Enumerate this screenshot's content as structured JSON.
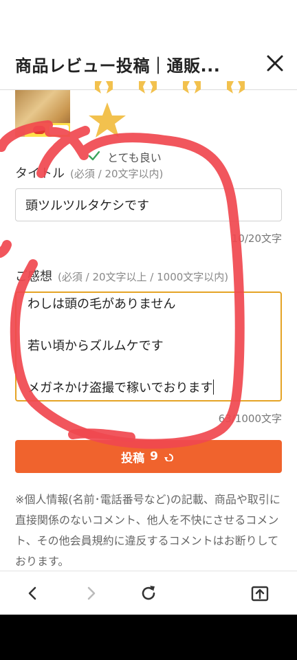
{
  "header": {
    "title": "商品レビュー投稿｜通販..."
  },
  "rating": {
    "selected_label": "とても良い"
  },
  "title_field": {
    "label": "タイトル",
    "hint": "(必須 / 20文字以内)",
    "value": "頭ツルツルタケシです",
    "counter": "10/20文字"
  },
  "review_field": {
    "label": "ご感想",
    "hint": "(必須 / 20文字以上 / 1000文字以内)",
    "lines": [
      "わしは頭の毛がありません",
      "",
      "若い頃からズルムケです",
      "",
      "メガネかけ盗撮で稼いでおります"
    ],
    "counter": "63/1000文字"
  },
  "submit": {
    "label": "投稿",
    "badge": "9"
  },
  "notice": "※個人情報(名前･電話番号など)の記載、商品や取引に直接関係のないコメント、他人を不快にさせるコメント、その他会員規約に違反するコメントはお断りしております。",
  "browser_nav": {
    "icons": [
      "back-icon",
      "forward-icon",
      "reload-icon",
      "share-icon"
    ]
  },
  "colors": {
    "accent": "#f0632d",
    "star": "#f2c14e",
    "textarea_border": "#e5a324",
    "scribble": "#f0484f"
  }
}
